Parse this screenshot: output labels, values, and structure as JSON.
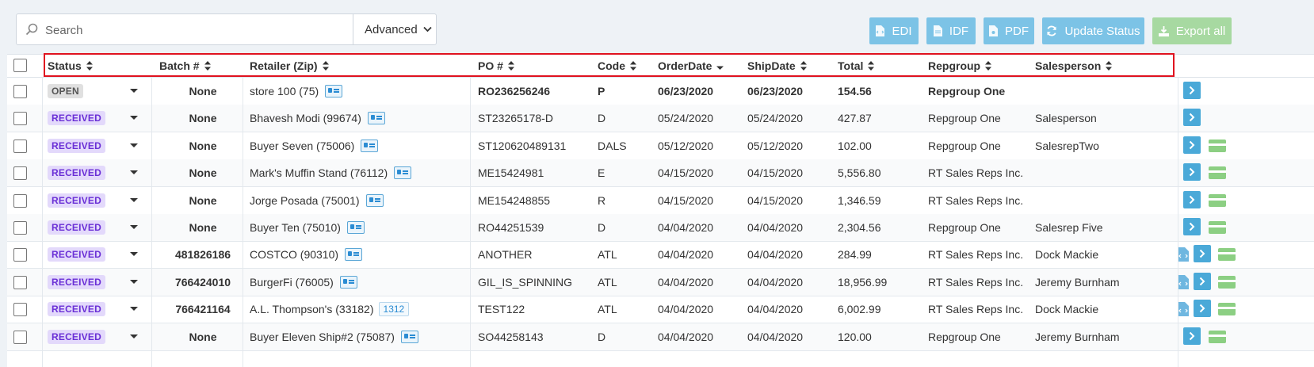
{
  "toolbar": {
    "search_placeholder": "Search",
    "advanced_label": "Advanced",
    "buttons": {
      "edi": "EDI",
      "idf": "IDF",
      "pdf": "PDF",
      "update_status": "Update Status",
      "export_all": "Export all"
    }
  },
  "colors": {
    "accent_blue": "#4aa9d8",
    "button_blue": "#7cc3e6",
    "button_green": "#a7d9a1",
    "received_bg": "#e3d9fb",
    "received_text": "#6a2fd6",
    "highlight_outline": "#e0121f"
  },
  "table": {
    "columns": [
      "Status",
      "Batch #",
      "Retailer (Zip)",
      "PO #",
      "Code",
      "OrderDate",
      "ShipDate",
      "Total",
      "Repgroup",
      "Salesperson"
    ],
    "rows": [
      {
        "status": "OPEN",
        "batch": "None",
        "retailer": "store 100 (75)",
        "po": "RO236256246",
        "code": "P",
        "order_date": "06/23/2020",
        "ship_date": "06/23/2020",
        "total": "154.56",
        "repgroup": "Repgroup One",
        "salesperson": ""
      },
      {
        "status": "RECEIVED",
        "batch": "None",
        "retailer": "Bhavesh Modi (99674)",
        "po": "ST23265178-D",
        "code": "D",
        "order_date": "05/24/2020",
        "ship_date": "05/24/2020",
        "total": "427.87",
        "repgroup": "Repgroup One",
        "salesperson": "Salesperson"
      },
      {
        "status": "RECEIVED",
        "batch": "None",
        "retailer": "Buyer Seven (75006)",
        "po": "ST120620489131",
        "code": "DALS",
        "order_date": "05/12/2020",
        "ship_date": "05/12/2020",
        "total": "102.00",
        "repgroup": "Repgroup One",
        "salesperson": "SalesrepTwo"
      },
      {
        "status": "RECEIVED",
        "batch": "None",
        "retailer": "Mark's Muffin Stand (76112)",
        "po": "ME15424981",
        "code": "E",
        "order_date": "04/15/2020",
        "ship_date": "04/15/2020",
        "total": "5,556.80",
        "repgroup": "RT Sales Reps Inc.",
        "salesperson": ""
      },
      {
        "status": "RECEIVED",
        "batch": "None",
        "retailer": "Jorge Posada (75001)",
        "po": "ME154248855",
        "code": "R",
        "order_date": "04/15/2020",
        "ship_date": "04/15/2020",
        "total": "1,346.59",
        "repgroup": "RT Sales Reps Inc.",
        "salesperson": ""
      },
      {
        "status": "RECEIVED",
        "batch": "None",
        "retailer": "Buyer Ten (75010)",
        "po": "RO44251539",
        "code": "D",
        "order_date": "04/04/2020",
        "ship_date": "04/04/2020",
        "total": "2,304.56",
        "repgroup": "Repgroup One",
        "salesperson": "Salesrep Five"
      },
      {
        "status": "RECEIVED",
        "batch": "481826186",
        "retailer": "COSTCO (90310)",
        "po": "ANOTHER",
        "code": "ATL",
        "order_date": "04/04/2020",
        "ship_date": "04/04/2020",
        "total": "284.99",
        "repgroup": "RT Sales Reps Inc.",
        "salesperson": "Dock Mackie"
      },
      {
        "status": "RECEIVED",
        "batch": "766424010",
        "retailer": "BurgerFi (76005)",
        "po": "GIL_IS_SPINNING",
        "code": "ATL",
        "order_date": "04/04/2020",
        "ship_date": "04/04/2020",
        "total": "18,956.99",
        "repgroup": "RT Sales Reps Inc.",
        "salesperson": "Jeremy Burnham"
      },
      {
        "status": "RECEIVED",
        "batch": "766421164",
        "retailer": "A.L. Thompson's (33182)",
        "retailer_count": "1312",
        "po": "TEST122",
        "code": "ATL",
        "order_date": "04/04/2020",
        "ship_date": "04/04/2020",
        "total": "6,002.99",
        "repgroup": "RT Sales Reps Inc.",
        "salesperson": "Dock Mackie"
      },
      {
        "status": "RECEIVED",
        "batch": "None",
        "retailer": "Buyer Eleven Ship#2 (75087)",
        "po": "SO44258143",
        "code": "D",
        "order_date": "04/04/2020",
        "ship_date": "04/04/2020",
        "total": "120.00",
        "repgroup": "Repgroup One",
        "salesperson": "Jeremy Burnham"
      }
    ]
  }
}
